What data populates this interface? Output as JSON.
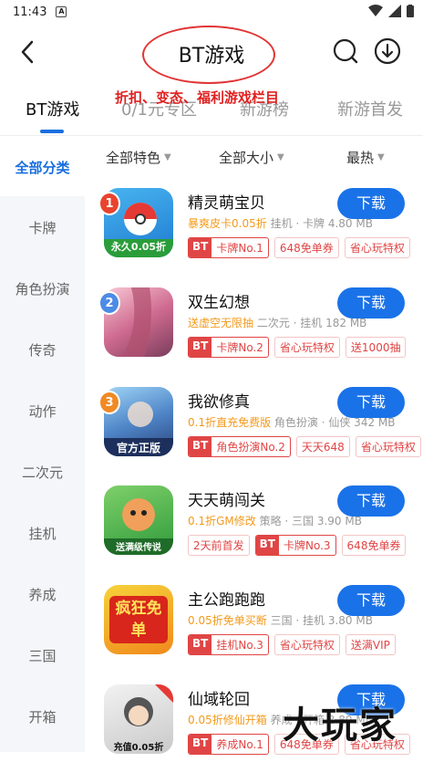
{
  "status_bar": {
    "time": "11:43",
    "notif_letter": "A"
  },
  "header": {
    "title": "BT游戏"
  },
  "annotation": {
    "text": "折扣、变态、福利游戏栏目"
  },
  "tabs": [
    {
      "label": "BT游戏",
      "active": true
    },
    {
      "label": "0/1元专区",
      "active": false
    },
    {
      "label": "新游榜",
      "active": false
    },
    {
      "label": "新游首发",
      "active": false
    }
  ],
  "sidebar": {
    "items": [
      {
        "label": "全部分类",
        "active": true
      },
      {
        "label": "卡牌"
      },
      {
        "label": "角色扮演"
      },
      {
        "label": "传奇"
      },
      {
        "label": "动作"
      },
      {
        "label": "二次元"
      },
      {
        "label": "挂机"
      },
      {
        "label": "养成"
      },
      {
        "label": "三国"
      },
      {
        "label": "开箱"
      }
    ]
  },
  "filters": [
    {
      "label": "全部特色"
    },
    {
      "label": "全部大小"
    },
    {
      "label": "最热"
    }
  ],
  "games": [
    {
      "rank": "1",
      "name": "精灵萌宝贝",
      "icon_text": "永久0.05折",
      "promo": "暴爽皮卡0.05折",
      "meta": "挂机 · 卡牌  4.80 MB",
      "tags": [
        {
          "bt": "BT",
          "label": "卡牌No.1"
        },
        {
          "label": "648免单券"
        },
        {
          "label": "省心玩特权"
        }
      ],
      "button": "下载"
    },
    {
      "rank": "2",
      "name": "双生幻想",
      "icon_text": "",
      "promo": "送虚空无限抽",
      "meta": "二次元 · 挂机  182 MB",
      "tags": [
        {
          "bt": "BT",
          "label": "卡牌No.2"
        },
        {
          "label": "省心玩特权"
        },
        {
          "label": "送1000抽"
        }
      ],
      "button": "下载"
    },
    {
      "rank": "3",
      "name": "我欲修真",
      "icon_text": "官方正版",
      "promo": "0.1折直充免费版",
      "meta": "角色扮演 · 仙侠  342 MB",
      "tags": [
        {
          "bt": "BT",
          "label": "角色扮演No.2"
        },
        {
          "label": "天天648"
        },
        {
          "label": "省心玩特权"
        }
      ],
      "button": "下载"
    },
    {
      "rank": "",
      "name": "天天萌闯关",
      "icon_text": "送满级传说",
      "promo": "0.1折GM修改",
      "meta": "策略 · 三国  3.90 MB",
      "tags": [
        {
          "label": "2天前首发"
        },
        {
          "bt": "BT",
          "label": "卡牌No.3"
        },
        {
          "label": "648免单券"
        }
      ],
      "button": "下载"
    },
    {
      "rank": "",
      "name": "主公跑跑跑",
      "icon_text": "疯狂免单",
      "promo": "0.05折免单买断",
      "meta": "三国 · 挂机  3.80 MB",
      "tags": [
        {
          "bt": "BT",
          "label": "挂机No.3"
        },
        {
          "label": "省心玩特权"
        },
        {
          "label": "送满VIP"
        }
      ],
      "button": "下载"
    },
    {
      "rank": "",
      "name": "仙域轮回",
      "icon_text": "充值0.05折",
      "promo": "0.05折修仙开箱",
      "meta": "养成 · 开箱  3.80 MB",
      "tags": [
        {
          "bt": "BT",
          "label": "养成No.1"
        },
        {
          "label": "648免单券"
        },
        {
          "label": "省心玩特权"
        }
      ],
      "button": "下载"
    }
  ],
  "watermark": "大玩家",
  "colors": {
    "accent": "#1a72e8",
    "tag_red": "#e04545",
    "promo_orange": "#f39a1c",
    "annotation_red": "#e02020"
  }
}
